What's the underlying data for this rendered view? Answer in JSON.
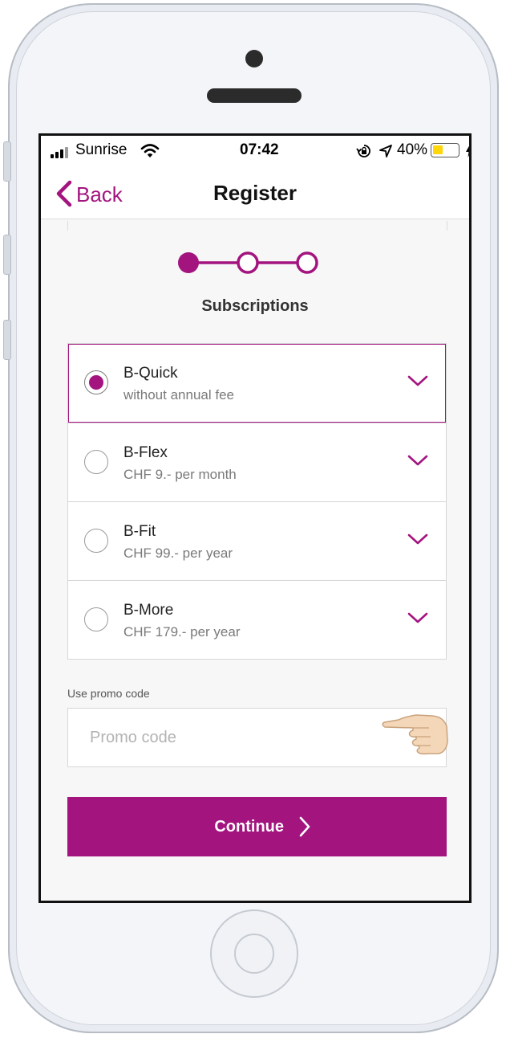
{
  "status_bar": {
    "carrier": "Sunrise",
    "time": "07:42",
    "battery_percent": "40%",
    "icons": [
      "signal-icon",
      "wifi-icon",
      "orientation-lock-icon",
      "location-icon",
      "battery-icon",
      "charging-icon"
    ]
  },
  "nav": {
    "back_label": "Back",
    "title": "Register"
  },
  "stepper": {
    "current_step": 1,
    "total_steps": 3,
    "step_title": "Subscriptions"
  },
  "subscriptions": [
    {
      "name": "B-Quick",
      "desc": "without annual fee",
      "selected": true
    },
    {
      "name": "B-Flex",
      "desc": "CHF 9.- per month",
      "selected": false
    },
    {
      "name": "B-Fit",
      "desc": "CHF 99.- per year",
      "selected": false
    },
    {
      "name": "B-More",
      "desc": "CHF 179.- per year",
      "selected": false
    }
  ],
  "promo": {
    "label": "Use promo code",
    "placeholder": "Promo code",
    "value": ""
  },
  "continue_label": "Continue",
  "colors": {
    "accent": "#a3147f",
    "battery": "#ffd60a"
  }
}
